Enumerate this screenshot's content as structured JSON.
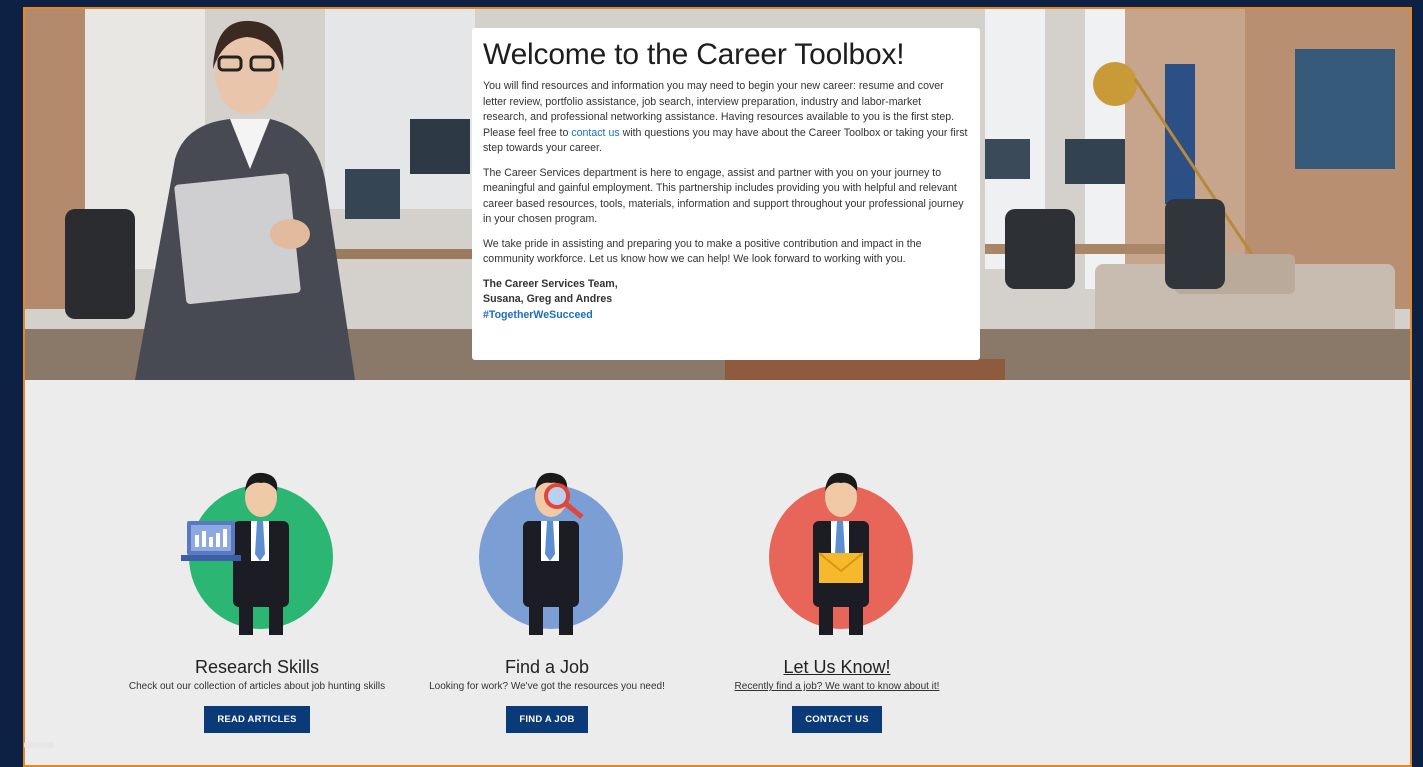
{
  "welcome": {
    "title": "Welcome to the Career Toolbox!",
    "p1_before": "You will find resources and information you may need to begin your new career: resume and cover letter review, portfolio assistance, job search, interview preparation, industry and labor-market research, and professional networking assistance. Having resources available to you is the first step. Please feel free to ",
    "p1_link": "contact us",
    "p1_after": " with questions you may have about the Career Toolbox or taking your first step towards your career.",
    "p2": "The Career Services department is here to engage, assist and partner with you on your journey to meaningful and gainful employment. This partnership includes providing you with helpful and relevant career based resources, tools, materials, information and support throughout your professional journey in your chosen program.",
    "p3": "We take pride in assisting and preparing you to make a positive contribution and impact in the community workforce. Let us know how we can help! We look forward to working with you.",
    "sig_line1": "The Career Services Team,",
    "sig_line2": "Susana, Greg and Andres",
    "hashtag": "#TogetherWeSucceed"
  },
  "cards": [
    {
      "title": "Research Skills",
      "desc": "Check out our collection of articles about job hunting skills",
      "button": "READ ARTICLES",
      "circle_color": "#2bb673",
      "icon": "laptop-chart-icon"
    },
    {
      "title": "Find a Job",
      "desc": "Looking for work? We've got the resources you need!",
      "button": "FIND A JOB",
      "circle_color": "#7b9fd4",
      "icon": "magnifier-icon"
    },
    {
      "title": "Let Us Know!",
      "desc": "Recently find a job? We want to know about it!",
      "button": "CONTACT US",
      "circle_color": "#e8655a",
      "icon": "envelope-icon"
    }
  ],
  "colors": {
    "background": "#0c2144",
    "frame_border": "#e0882a",
    "button": "#0b3a78",
    "link": "#1a6fc0"
  }
}
